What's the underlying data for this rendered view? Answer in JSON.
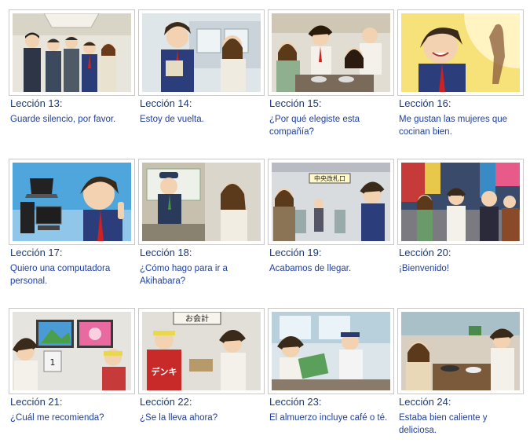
{
  "lessons": [
    {
      "title": "Lección 13:",
      "desc": "Guarde silencio, por favor."
    },
    {
      "title": "Lección 14:",
      "desc": "Estoy de vuelta."
    },
    {
      "title": "Lección 15:",
      "desc": "¿Por qué elegiste esta compañía?"
    },
    {
      "title": "Lección 16:",
      "desc": "Me gustan las mujeres que cocinan bien."
    },
    {
      "title": "Lección 17:",
      "desc": "Quiero una computadora personal."
    },
    {
      "title": "Lección 18:",
      "desc": "¿Cómo hago para ir a Akihabara?"
    },
    {
      "title": "Lección 19:",
      "desc": "Acabamos de llegar."
    },
    {
      "title": "Lección 20:",
      "desc": "¡Bienvenido!"
    },
    {
      "title": "Lección 21:",
      "desc": "¿Cuál me recomienda?"
    },
    {
      "title": "Lección 22:",
      "desc": "¿Se la lleva ahora?"
    },
    {
      "title": "Lección 23:",
      "desc": "El almuerzo incluye café o té."
    },
    {
      "title": "Lección 24:",
      "desc": "Estaba bien caliente y deliciosa."
    }
  ],
  "scene_text": {
    "station_sign": "中央改札口",
    "shop_sign": "お会計",
    "shop_apron": "デンキ",
    "pos_price": "1"
  },
  "colors": {
    "title": "#1a3a7a",
    "desc": "#1e3fa0",
    "border": "#c8c8c8"
  }
}
